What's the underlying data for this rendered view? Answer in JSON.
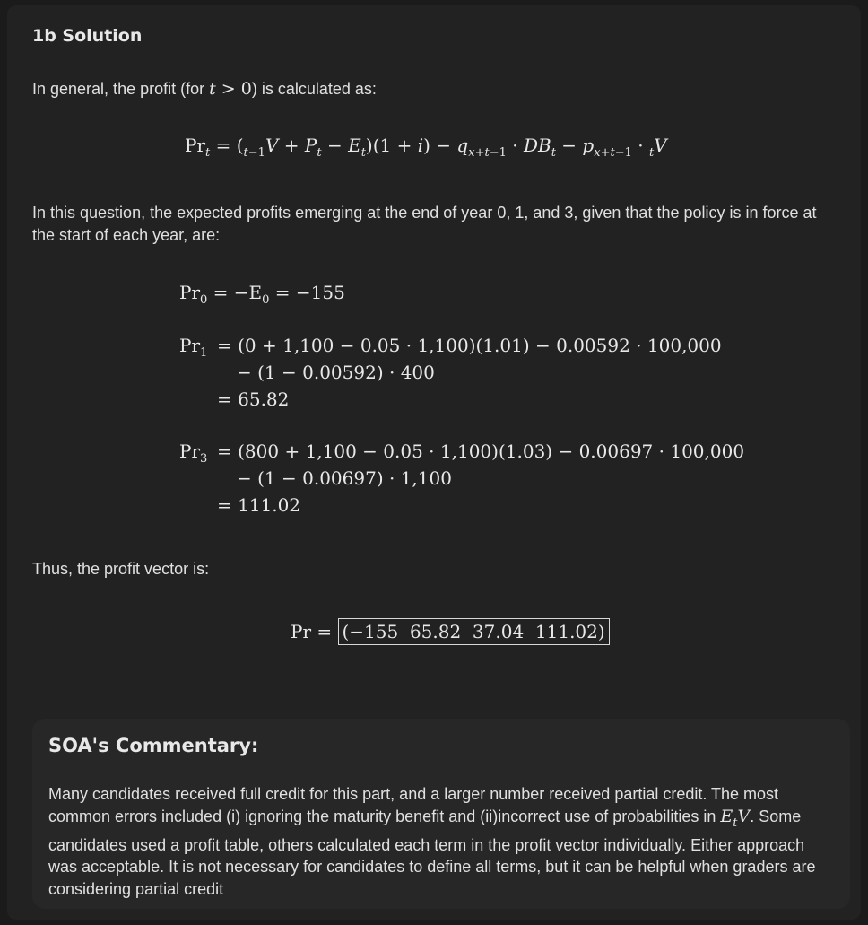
{
  "heading": "1b Solution",
  "intro": {
    "prefix": "In general, the profit (for ",
    "inline_math": "t > 0",
    "suffix": ") is calculated as:"
  },
  "general_formula": "Pr_t = (_{t−1}V + P_t − E_t)(1 + i) − q_{x+t−1} · DB_t − p_{x+t−1} · _tV",
  "question_text": "In this question, the expected profits emerging at the end of year 0, 1, and 3, given that the policy is in force at the start of each year, are:",
  "eq0": {
    "lhs": "Pr",
    "sub": "0",
    "rhs": "= −E",
    "rhs_sub": "0",
    "rhs_tail": " = −155"
  },
  "eq1": {
    "lhs": "Pr",
    "sub": "1",
    "line1": "= (0 + 1,100 − 0.05 · 1,100)(1.01) − 0.00592 · 100,000",
    "line2": "− (1 − 0.00592) · 400",
    "line3": "= 65.82"
  },
  "eq3": {
    "lhs": "Pr",
    "sub": "3",
    "line1": "= (800 + 1,100 − 0.05 · 1,100)(1.03) − 0.00697 · 100,000",
    "line2": "− (1 − 0.00697) · 1,100",
    "line3": "= 111.02"
  },
  "thus_text": "Thus, the profit vector is:",
  "vector": {
    "lhs": "Pr =",
    "boxed": "(−155  65.82  37.04  111.02)"
  },
  "commentary": {
    "title": "SOA's Commentary:",
    "body_part1": "Many candidates received full credit for this part, and a larger number received partial credit. The most common errors included (i) ignoring the maturity benefit and (ii)incorrect use of probabilities in ",
    "inline_math": "E_tV",
    "body_part2": ". Some candidates used a profit table, others calculated each term in the profit vector individually. Either approach was acceptable. It is not necessary for candidates to define all terms, but it can be helpful when graders are considering partial credit"
  }
}
